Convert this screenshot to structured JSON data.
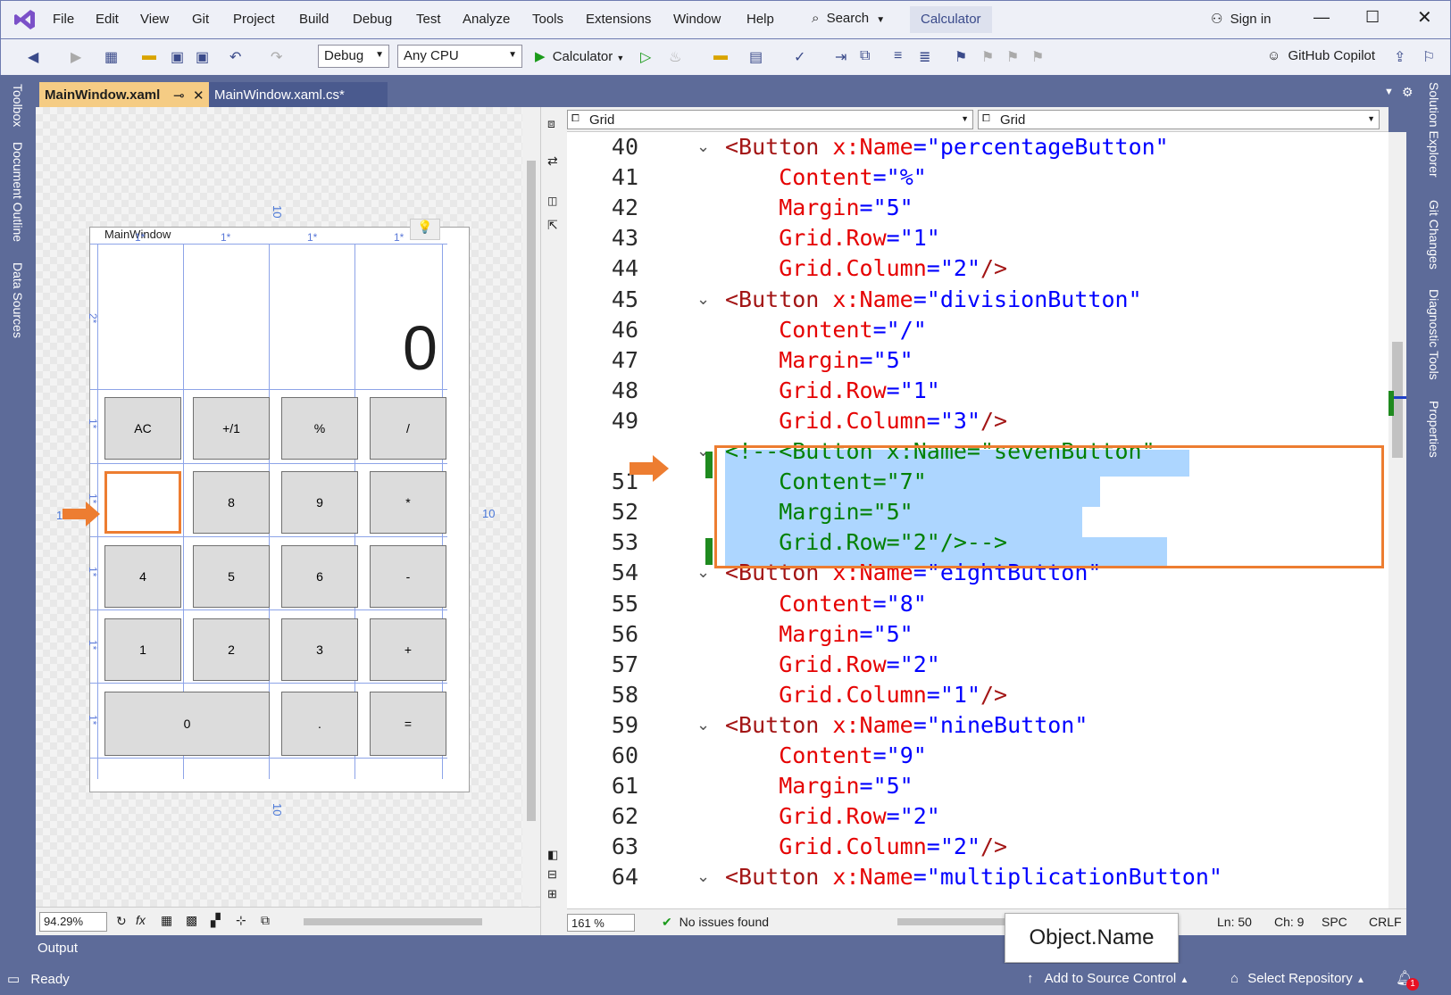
{
  "menu": {
    "file": "File",
    "edit": "Edit",
    "view": "View",
    "git": "Git",
    "project": "Project",
    "build": "Build",
    "debug": "Debug",
    "test": "Test",
    "analyze": "Analyze",
    "tools": "Tools",
    "extensions": "Extensions",
    "window": "Window",
    "help": "Help"
  },
  "search": {
    "label": "Search"
  },
  "solution_badge": "Calculator",
  "sign_in": "Sign in",
  "toolbar": {
    "config": "Debug",
    "platform": "Any CPU",
    "run_target": "Calculator",
    "copilot": "GitHub Copilot"
  },
  "side_left": {
    "toolbox": "Toolbox",
    "doc_outline": "Document Outline",
    "data_sources": "Data Sources"
  },
  "side_right": {
    "solution_explorer": "Solution Explorer",
    "git_changes": "Git Changes",
    "diag_tools": "Diagnostic Tools",
    "properties": "Properties"
  },
  "tabs": [
    {
      "label": "MainWindow.xaml"
    },
    {
      "label": "MainWindow.xaml.cs*"
    }
  ],
  "designer": {
    "window_title": "MainWindow",
    "display_value": "0",
    "col_labels": [
      "1*",
      "1*",
      "1*",
      "1*"
    ],
    "row_labels": [
      "2*",
      "1*",
      "1*",
      "1*",
      "1*",
      "1*"
    ],
    "margin_top": "10",
    "margin_right": "10",
    "margin_bottom": "10",
    "margin_left": "1",
    "buttons": {
      "ac": "AC",
      "plusminus": "+/1",
      "percent": "%",
      "divide": "/",
      "eight": "8",
      "nine": "9",
      "multiply": "*",
      "four": "4",
      "five": "5",
      "six": "6",
      "minus": "-",
      "one": "1",
      "two": "2",
      "three": "3",
      "plus": "+",
      "zero": "0",
      "dot": ".",
      "equals": "="
    },
    "zoom": "94.29%"
  },
  "editor": {
    "nav_left": "Grid",
    "nav_right": "Grid",
    "lines": [
      {
        "n": "40",
        "parts": [
          [
            "tag",
            "<Button "
          ],
          [
            "attr",
            "x:Name"
          ],
          [
            "pun",
            "="
          ],
          [
            "val",
            "\"percentageButton\""
          ]
        ]
      },
      {
        "n": "41",
        "parts": [
          [
            "attr",
            "    Content"
          ],
          [
            "pun",
            "="
          ],
          [
            "val",
            "\"%\""
          ]
        ]
      },
      {
        "n": "42",
        "parts": [
          [
            "attr",
            "    Margin"
          ],
          [
            "pun",
            "="
          ],
          [
            "val",
            "\"5\""
          ]
        ]
      },
      {
        "n": "43",
        "parts": [
          [
            "attr",
            "    Grid.Row"
          ],
          [
            "pun",
            "="
          ],
          [
            "val",
            "\"1\""
          ]
        ]
      },
      {
        "n": "44",
        "parts": [
          [
            "attr",
            "    Grid.Column"
          ],
          [
            "pun",
            "="
          ],
          [
            "val",
            "\"2\""
          ],
          [
            "tag",
            "/>"
          ]
        ]
      },
      {
        "n": "45",
        "parts": [
          [
            "tag",
            "<Button "
          ],
          [
            "attr",
            "x:Name"
          ],
          [
            "pun",
            "="
          ],
          [
            "val",
            "\"divisionButton\""
          ]
        ]
      },
      {
        "n": "46",
        "parts": [
          [
            "attr",
            "    Content"
          ],
          [
            "pun",
            "="
          ],
          [
            "val",
            "\"/\""
          ]
        ]
      },
      {
        "n": "47",
        "parts": [
          [
            "attr",
            "    Margin"
          ],
          [
            "pun",
            "="
          ],
          [
            "val",
            "\"5\""
          ]
        ]
      },
      {
        "n": "48",
        "parts": [
          [
            "attr",
            "    Grid.Row"
          ],
          [
            "pun",
            "="
          ],
          [
            "val",
            "\"1\""
          ]
        ]
      },
      {
        "n": "49",
        "parts": [
          [
            "attr",
            "    Grid.Column"
          ],
          [
            "pun",
            "="
          ],
          [
            "val",
            "\"3\""
          ],
          [
            "tag",
            "/>"
          ]
        ]
      },
      {
        "n": "",
        "parts": [
          [
            "cmt",
            "<!--<Button x:Name=\"sevenButton\""
          ]
        ]
      },
      {
        "n": "51",
        "parts": [
          [
            "cmt",
            "    Content=\"7\""
          ]
        ]
      },
      {
        "n": "52",
        "parts": [
          [
            "cmt",
            "    Margin=\"5\""
          ]
        ]
      },
      {
        "n": "53",
        "parts": [
          [
            "cmt",
            "    Grid.Row=\"2\"/>-->"
          ]
        ]
      },
      {
        "n": "54",
        "parts": [
          [
            "tag",
            "<Button "
          ],
          [
            "attr",
            "x:Name"
          ],
          [
            "pun",
            "="
          ],
          [
            "val",
            "\"eightButton\""
          ]
        ]
      },
      {
        "n": "55",
        "parts": [
          [
            "attr",
            "    Content"
          ],
          [
            "pun",
            "="
          ],
          [
            "val",
            "\"8\""
          ]
        ]
      },
      {
        "n": "56",
        "parts": [
          [
            "attr",
            "    Margin"
          ],
          [
            "pun",
            "="
          ],
          [
            "val",
            "\"5\""
          ]
        ]
      },
      {
        "n": "57",
        "parts": [
          [
            "attr",
            "    Grid.Row"
          ],
          [
            "pun",
            "="
          ],
          [
            "val",
            "\"2\""
          ]
        ]
      },
      {
        "n": "58",
        "parts": [
          [
            "attr",
            "    Grid.Column"
          ],
          [
            "pun",
            "="
          ],
          [
            "val",
            "\"1\""
          ],
          [
            "tag",
            "/>"
          ]
        ]
      },
      {
        "n": "59",
        "parts": [
          [
            "tag",
            "<Button "
          ],
          [
            "attr",
            "x:Name"
          ],
          [
            "pun",
            "="
          ],
          [
            "val",
            "\"nineButton\""
          ]
        ]
      },
      {
        "n": "60",
        "parts": [
          [
            "attr",
            "    Content"
          ],
          [
            "pun",
            "="
          ],
          [
            "val",
            "\"9\""
          ]
        ]
      },
      {
        "n": "61",
        "parts": [
          [
            "attr",
            "    Margin"
          ],
          [
            "pun",
            "="
          ],
          [
            "val",
            "\"5\""
          ]
        ]
      },
      {
        "n": "62",
        "parts": [
          [
            "attr",
            "    Grid.Row"
          ],
          [
            "pun",
            "="
          ],
          [
            "val",
            "\"2\""
          ]
        ]
      },
      {
        "n": "63",
        "parts": [
          [
            "attr",
            "    Grid.Column"
          ],
          [
            "pun",
            "="
          ],
          [
            "val",
            "\"2\""
          ],
          [
            "tag",
            "/>"
          ]
        ]
      },
      {
        "n": "64",
        "parts": [
          [
            "tag",
            "<Button "
          ],
          [
            "attr",
            "x:Name"
          ],
          [
            "pun",
            "="
          ],
          [
            "val",
            "\"multiplicationButton\""
          ]
        ]
      }
    ],
    "zoom": "161 %",
    "issues": "No issues found",
    "ln": "Ln: 50",
    "ch": "Ch: 9",
    "spc": "SPC",
    "crlf": "CRLF"
  },
  "tooltip": "Object.Name",
  "output_label": "Output",
  "status": {
    "ready": "Ready",
    "source_control": "Add to Source Control",
    "select_repo": "Select Repository",
    "notif_count": "1"
  },
  "colors": {
    "accent": "#5d6b99",
    "highlight": "#add6ff",
    "callout": "#ed7d31",
    "tab_active": "#f5cc84"
  }
}
